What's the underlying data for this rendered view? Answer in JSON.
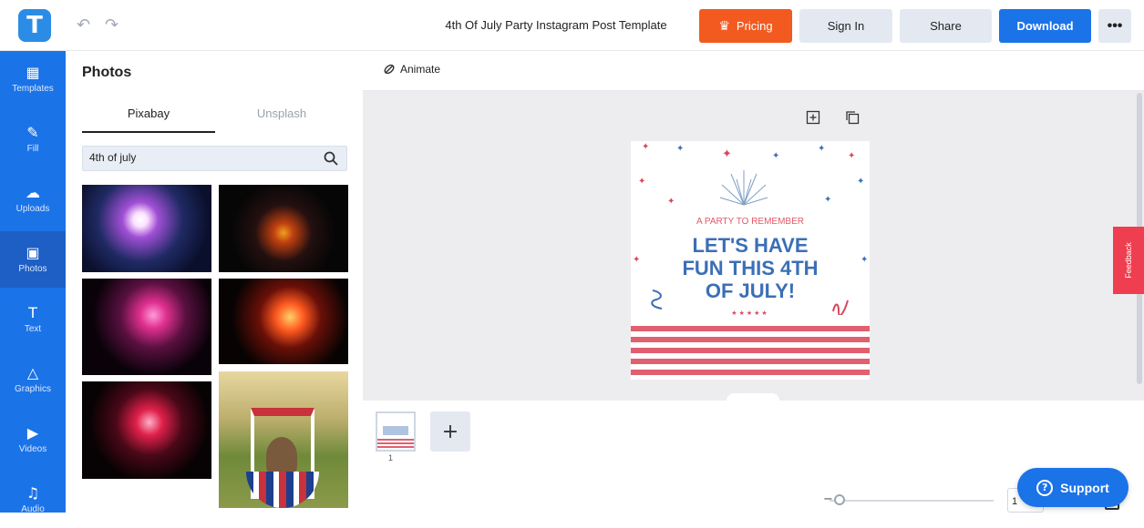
{
  "app": {
    "logo_letter": "T",
    "undo_icon": "↶",
    "redo_icon": "↷"
  },
  "header": {
    "title": "4th Of July Party Instagram Post Template",
    "pricing_label": "Pricing",
    "signin_label": "Sign In",
    "share_label": "Share",
    "download_label": "Download",
    "more_label": "•••"
  },
  "sidebar": {
    "items": [
      {
        "label": "Templates",
        "icon": "▦"
      },
      {
        "label": "Fill",
        "icon": "✎"
      },
      {
        "label": "Uploads",
        "icon": "☁"
      },
      {
        "label": "Photos",
        "icon": "▣"
      },
      {
        "label": "Text",
        "icon": "T"
      },
      {
        "label": "Graphics",
        "icon": "△"
      },
      {
        "label": "Videos",
        "icon": "▶"
      },
      {
        "label": "Audio",
        "icon": "♫"
      }
    ]
  },
  "panel": {
    "title": "Photos",
    "tabs": [
      {
        "label": "Pixabay"
      },
      {
        "label": "Unsplash"
      }
    ],
    "search_value": "4th of july"
  },
  "toolbar": {
    "animate_label": "Animate"
  },
  "design": {
    "subtitle": "A PARTY TO REMEMBER",
    "headline_lines": [
      "LET'S HAVE",
      "FUN THIS 4TH",
      "OF JULY!"
    ],
    "stars": "★★★★★"
  },
  "feedback_label": "Feedback",
  "pages": {
    "current_page": "1",
    "add_label": "+"
  },
  "zoom": {
    "value": "1"
  },
  "support_label": "Support",
  "colors": {
    "primary": "#1b73e8",
    "pricing": "#f25a1f",
    "feedback": "#ef3e50"
  }
}
